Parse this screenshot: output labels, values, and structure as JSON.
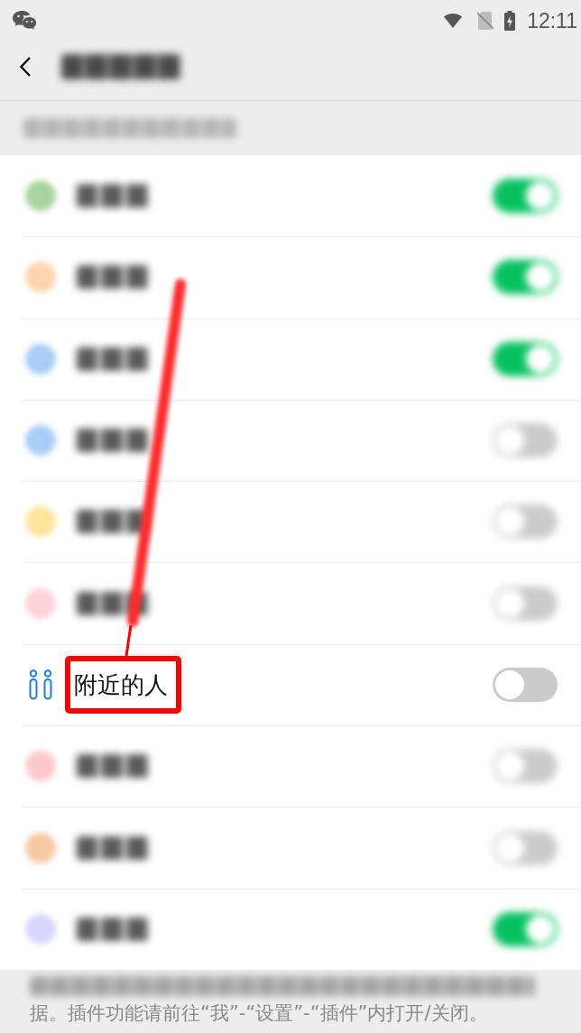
{
  "status_bar": {
    "time": "12:11"
  },
  "header": {
    "title": {
      "blurred": true
    }
  },
  "section_header": {
    "blurred": true
  },
  "rows": [
    {
      "blurred": true,
      "color": "#a9d39e",
      "on": true,
      "highlighted": false
    },
    {
      "blurred": true,
      "color": "#fcd4ae",
      "on": true,
      "highlighted": false
    },
    {
      "blurred": true,
      "color": "#a8cdf6",
      "on": true,
      "highlighted": false
    },
    {
      "blurred": true,
      "color": "#a8cdf6",
      "on": false,
      "highlighted": false
    },
    {
      "blurred": true,
      "color": "#fde49b",
      "on": false,
      "highlighted": false
    },
    {
      "blurred": true,
      "color": "#fcd3d8",
      "on": false,
      "highlighted": false
    },
    {
      "blurred": false,
      "label": "附近的人",
      "on": false,
      "highlighted": true
    },
    {
      "blurred": true,
      "color": "#fcc8cc",
      "on": false,
      "highlighted": false
    },
    {
      "blurred": true,
      "color": "#f5c9a3",
      "on": false,
      "highlighted": false
    },
    {
      "blurred": true,
      "color": "#d8d6fb",
      "on": true,
      "highlighted": false
    }
  ],
  "footer": {
    "lines": [
      {
        "blurred": true
      },
      {
        "blurred": false,
        "text": "据。插件功能请前往“我”-“设置”-“插件”内打开/关闭。"
      }
    ]
  }
}
